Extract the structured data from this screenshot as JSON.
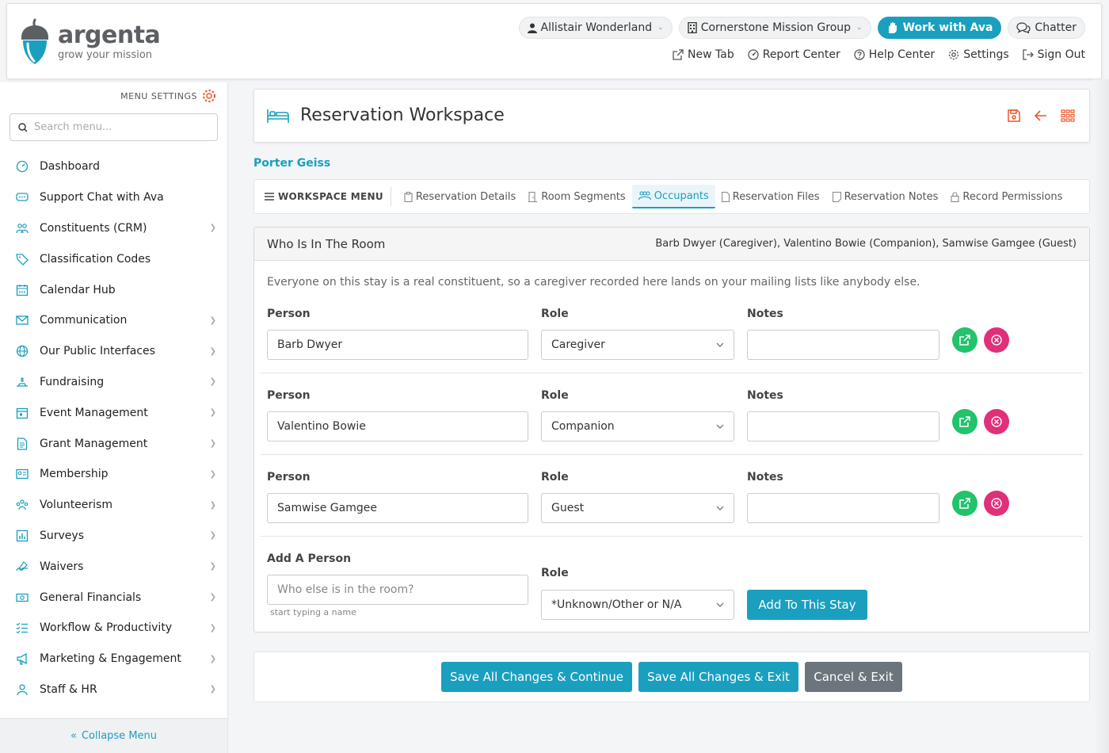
{
  "brand": {
    "name": "argenta",
    "tagline": "grow your mission",
    "accent": "#1a9fbf"
  },
  "header": {
    "user_label": "Allistair Wonderland",
    "org_label": "Cornerstone Mission Group",
    "ava_label": "Work with Ava",
    "chatter_label": "Chatter",
    "links": {
      "new_tab": "New Tab",
      "report_center": "Report Center",
      "help_center": "Help Center",
      "settings": "Settings",
      "sign_out": "Sign Out"
    }
  },
  "sidebar": {
    "menu_settings": "MENU SETTINGS",
    "search_placeholder": "Search menu...",
    "items": [
      {
        "label": "Dashboard",
        "icon": "dashboard-icon"
      },
      {
        "label": "Support Chat with Ava",
        "icon": "chat-icon"
      },
      {
        "label": "Constituents (CRM)",
        "icon": "people-icon"
      },
      {
        "label": "Classification Codes",
        "icon": "tag-icon"
      },
      {
        "label": "Calendar Hub",
        "icon": "calendar-icon"
      },
      {
        "label": "Communication",
        "icon": "envelope-icon"
      },
      {
        "label": "Our Public Interfaces",
        "icon": "globe-icon"
      },
      {
        "label": "Fundraising",
        "icon": "donate-icon"
      },
      {
        "label": "Event Management",
        "icon": "event-icon"
      },
      {
        "label": "Grant Management",
        "icon": "document-icon"
      },
      {
        "label": "Membership",
        "icon": "id-card-icon"
      },
      {
        "label": "Volunteerism",
        "icon": "group-icon"
      },
      {
        "label": "Surveys",
        "icon": "chart-icon"
      },
      {
        "label": "Waivers",
        "icon": "signature-icon"
      },
      {
        "label": "General Financials",
        "icon": "money-icon"
      },
      {
        "label": "Workflow & Productivity",
        "icon": "list-check-icon"
      },
      {
        "label": "Marketing & Engagement",
        "icon": "megaphone-icon"
      },
      {
        "label": "Staff & HR",
        "icon": "user-icon"
      }
    ],
    "collapse_label": "Collapse Menu"
  },
  "workspace": {
    "title": "Reservation Workspace",
    "constituent": "Porter Geiss",
    "menu_label": "WORKSPACE MENU",
    "tabs": [
      {
        "label": "Reservation Details"
      },
      {
        "label": "Room Segments"
      },
      {
        "label": "Occupants",
        "active": true
      },
      {
        "label": "Reservation Files"
      },
      {
        "label": "Reservation Notes"
      },
      {
        "label": "Record Permissions"
      }
    ]
  },
  "panel": {
    "title": "Who Is In The Room",
    "summary": "Barb Dwyer (Caregiver), Valentino Bowie (Companion), Samwise Gamgee (Guest)",
    "intro": "Everyone on this stay is a real constituent, so a caregiver recorded here lands on your mailing lists like anybody else.",
    "labels": {
      "person": "Person",
      "role": "Role",
      "notes": "Notes"
    },
    "occupants": [
      {
        "person": "Barb Dwyer",
        "role": "Caregiver",
        "notes": ""
      },
      {
        "person": "Valentino Bowie",
        "role": "Companion",
        "notes": ""
      },
      {
        "person": "Samwise Gamgee",
        "role": "Guest",
        "notes": ""
      }
    ],
    "add": {
      "label": "Add A Person",
      "placeholder": "Who else is in the room?",
      "hint": "start typing a name",
      "role_label": "Role",
      "role_value": "*Unknown/Other or N/A",
      "button": "Add To This Stay"
    }
  },
  "actions": {
    "save_continue": "Save All Changes & Continue",
    "save_exit": "Save All Changes & Exit",
    "cancel_exit": "Cancel & Exit"
  }
}
